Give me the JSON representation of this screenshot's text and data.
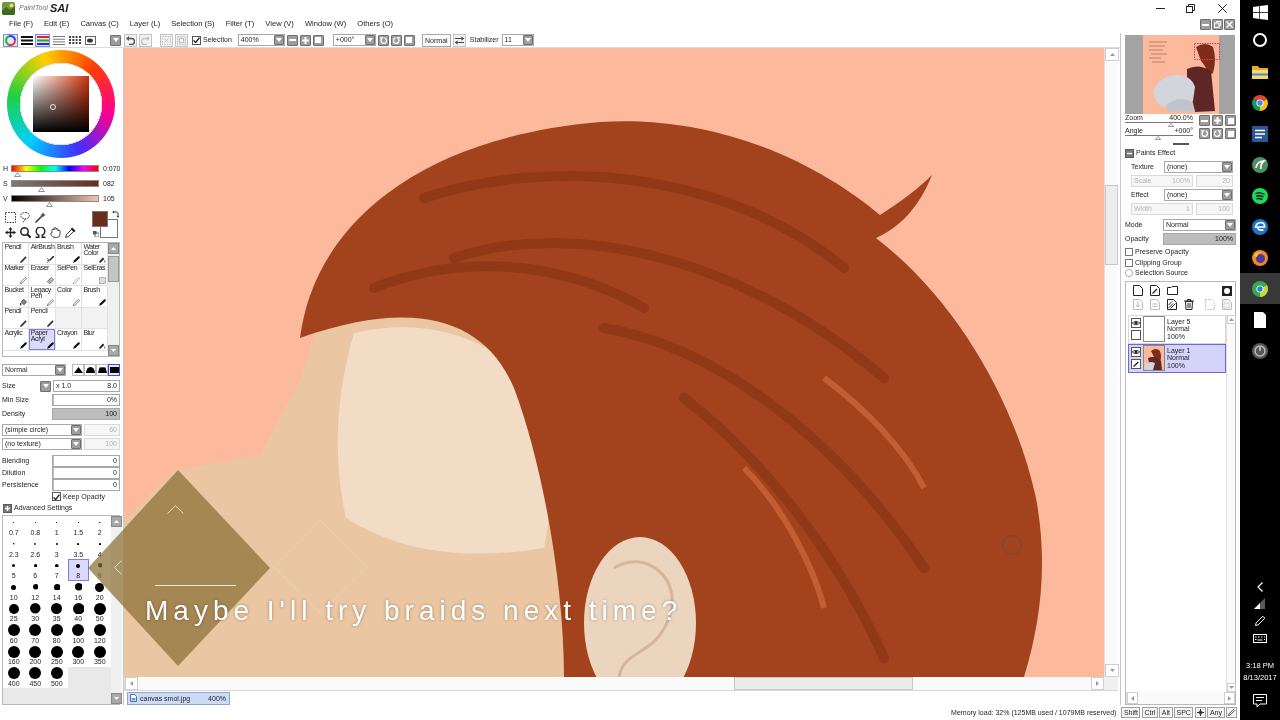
{
  "app_title": {
    "prefix": "PaintTool",
    "name": "SAI"
  },
  "menu": [
    "File (F)",
    "Edit (E)",
    "Canvas (C)",
    "Layer (L)",
    "Selection (S)",
    "Filter (T)",
    "View (V)",
    "Window (W)",
    "Others (O)"
  ],
  "toolbar": {
    "panel_toggles": [
      {
        "kind": "wheel",
        "selected": true
      },
      {
        "kind": "bars",
        "selected": false
      },
      {
        "kind": "rgb",
        "selected": true
      },
      {
        "kind": "lines",
        "selected": false
      },
      {
        "kind": "dots",
        "selected": false
      },
      {
        "kind": "pad",
        "selected": false
      }
    ],
    "edit_buttons": [
      {
        "kind": "undo",
        "disabled": false
      },
      {
        "kind": "redo",
        "disabled": true
      },
      {
        "kind": "deselect",
        "disabled": true
      },
      {
        "kind": "invert",
        "disabled": true
      }
    ],
    "selection": {
      "label": "Selection",
      "checked": true
    },
    "zoom": "400%",
    "angle": "+000°",
    "mode_button": "Normal",
    "stabilizer": {
      "label": "Stabilizer",
      "value": "11"
    }
  },
  "color_panel": {
    "sliders": [
      {
        "kind": "hue",
        "label": "H",
        "level": 0.07,
        "reading": "0:070"
      },
      {
        "kind": "saturation",
        "label": "S",
        "level": 0.35,
        "reading": "082"
      },
      {
        "kind": "value",
        "label": "V",
        "level": 0.44,
        "reading": "105"
      }
    ],
    "swatches": [
      {
        "kind": "foreground",
        "color": "#6b2e1c"
      },
      {
        "kind": "background",
        "color": "#ffffff"
      }
    ]
  },
  "tool_rows": [
    [
      {
        "label": "Pencil",
        "kind": "pen",
        "selected": false
      },
      {
        "label": "AirBrush",
        "kind": "spray",
        "selected": false
      },
      {
        "label": "Brush",
        "kind": "brush",
        "selected": false
      },
      {
        "label": "Water Color",
        "kind": "water",
        "selected": false
      }
    ],
    [
      {
        "label": "Marker",
        "kind": "marker",
        "selected": false
      },
      {
        "label": "Eraser",
        "kind": "eraser",
        "selected": false
      },
      {
        "label": "SelPen",
        "kind": "selpen",
        "selected": false
      },
      {
        "label": "SelEras",
        "kind": "seleras",
        "selected": false
      }
    ],
    [
      {
        "label": "Bucket",
        "kind": "bucket",
        "selected": false
      },
      {
        "label": "Legacy Pen",
        "kind": "marker",
        "selected": false
      },
      {
        "label": "Color",
        "kind": "marker",
        "selected": false
      },
      {
        "label": "Brush",
        "kind": "brush",
        "selected": false
      }
    ],
    [
      {
        "label": "Pencil",
        "kind": "pen",
        "selected": false
      },
      {
        "label": "Pencil",
        "kind": "pen",
        "selected": false
      }
    ],
    [
      {
        "label": "Acrylic",
        "kind": "brush",
        "selected": false
      },
      {
        "label": "Paper Acryl",
        "kind": "brush",
        "selected": true
      },
      {
        "label": "Crayon",
        "kind": "brush",
        "selected": false
      },
      {
        "label": "Blur",
        "kind": "water",
        "selected": false
      }
    ]
  ],
  "brush_settings": {
    "blend_mode": "Normal",
    "tip_shapes": [
      {
        "kind": "pointed",
        "selected": false
      },
      {
        "kind": "round",
        "selected": false
      },
      {
        "kind": "flat",
        "selected": false
      },
      {
        "kind": "square",
        "selected": true
      }
    ],
    "size": {
      "label": "Size",
      "multiplier": "x 1.0",
      "value": "8.0"
    },
    "sliders": [
      {
        "label": "Min Size",
        "value": "0%",
        "level": 0
      },
      {
        "label": "Density",
        "value": "100",
        "level": 1
      }
    ],
    "shape": {
      "value": "(simple circle)",
      "amount": "60",
      "disabled": true
    },
    "texture": {
      "value": "(no texture)",
      "amount": "100",
      "disabled": true
    },
    "mixing": [
      {
        "label": "Blending",
        "value": "0",
        "level": 0
      },
      {
        "label": "Dilution",
        "value": "0",
        "level": 0
      },
      {
        "label": "Persistence",
        "value": "0",
        "level": 0
      }
    ],
    "keep_opacity": {
      "label": "Keep Opacity",
      "checked": true
    },
    "advanced": {
      "label": "Advanced Settings",
      "expanded": false
    }
  },
  "brush_sizes": [
    {
      "label": "0.7",
      "selected": false
    },
    {
      "label": "0.8",
      "selected": false
    },
    {
      "label": "1",
      "selected": false
    },
    {
      "label": "1.5",
      "selected": false
    },
    {
      "label": "2",
      "selected": false
    },
    {
      "label": "2.3",
      "selected": false
    },
    {
      "label": "2.6",
      "selected": false
    },
    {
      "label": "3",
      "selected": false
    },
    {
      "label": "3.5",
      "selected": false
    },
    {
      "label": "4",
      "selected": false
    },
    {
      "label": "5",
      "selected": false
    },
    {
      "label": "6",
      "selected": false
    },
    {
      "label": "7",
      "selected": false
    },
    {
      "label": "8",
      "selected": true
    },
    {
      "label": "9",
      "selected": false
    },
    {
      "label": "10",
      "selected": false
    },
    {
      "label": "12",
      "selected": false
    },
    {
      "label": "14",
      "selected": false
    },
    {
      "label": "16",
      "selected": false
    },
    {
      "label": "20",
      "selected": false
    },
    {
      "label": "25",
      "selected": false
    },
    {
      "label": "30",
      "selected": false
    },
    {
      "label": "35",
      "selected": false
    },
    {
      "label": "40",
      "selected": false
    },
    {
      "label": "50",
      "selected": false
    },
    {
      "label": "60",
      "selected": false
    },
    {
      "label": "70",
      "selected": false
    },
    {
      "label": "80",
      "selected": false
    },
    {
      "label": "100",
      "selected": false
    },
    {
      "label": "120",
      "selected": false
    },
    {
      "label": "160",
      "selected": false
    },
    {
      "label": "200",
      "selected": false
    },
    {
      "label": "250",
      "selected": false
    },
    {
      "label": "300",
      "selected": false
    },
    {
      "label": "350",
      "selected": false
    },
    {
      "label": "400",
      "selected": false
    },
    {
      "label": "450",
      "selected": false
    },
    {
      "label": "500",
      "selected": false
    }
  ],
  "video_caption": {
    "text": "Maybe I'll try braids next time?"
  },
  "navigator": {
    "zoom": {
      "label": "Zoom",
      "value": "400.0%",
      "level": 0.68
    },
    "angle": {
      "label": "Angle",
      "value": "+000°",
      "level": 0.48
    }
  },
  "paints_effect": {
    "title": "Paints Effect",
    "expanded": true,
    "rows": [
      {
        "kind": "select",
        "label": "Texture",
        "value": "(none)"
      },
      {
        "kind": "pair",
        "label": "Scale",
        "value": "100%",
        "amount": "20",
        "disabled": true
      },
      {
        "kind": "select",
        "label": "Effect",
        "value": "(none)"
      },
      {
        "kind": "pair",
        "label": "Width",
        "value": "1",
        "amount": "100",
        "disabled": true
      }
    ]
  },
  "layer_props": {
    "mode": {
      "label": "Mode",
      "value": "Normal"
    },
    "opacity": {
      "label": "Opacity",
      "value": "100%",
      "level": 1
    },
    "options": [
      {
        "kind": "checkbox",
        "label": "Preserve Opacity",
        "checked": false
      },
      {
        "kind": "checkbox",
        "label": "Clipping Group",
        "checked": false
      },
      {
        "kind": "radio",
        "label": "Selection Source",
        "checked": false
      }
    ]
  },
  "layer_tool_rows": [
    [
      {
        "kind": "new-layer",
        "disabled": false
      },
      {
        "kind": "new-linear",
        "disabled": false
      },
      {
        "kind": "new-folder",
        "disabled": false
      },
      {
        "kind": "mask",
        "disabled": false
      }
    ],
    [
      {
        "kind": "transfer",
        "disabled": true
      },
      {
        "kind": "merge",
        "disabled": true
      },
      {
        "kind": "clear",
        "disabled": false
      },
      {
        "kind": "delete",
        "disabled": false
      },
      {
        "kind": "to-selection",
        "disabled": true
      },
      {
        "kind": "from-selection",
        "disabled": true
      }
    ]
  ],
  "layers": [
    {
      "name": "Layer 5",
      "mode": "Normal",
      "opacity": "100%",
      "visible": true,
      "selected": false,
      "kind": "blank"
    },
    {
      "name": "Layer 1",
      "mode": "Normal",
      "opacity": "100%",
      "visible": true,
      "selected": true,
      "kind": "art"
    }
  ],
  "canvas_tabs": [
    {
      "name": "canvas smol.jpg",
      "zoom": "400%",
      "selected": true
    }
  ],
  "status_bar": {
    "memory": "Memory load: 32% (125MB used / 1079MB reserved)",
    "keys": [
      {
        "kind": "text",
        "label": "Shift"
      },
      {
        "kind": "text",
        "label": "Ctrl"
      },
      {
        "kind": "text",
        "label": "Alt"
      },
      {
        "kind": "text",
        "label": "SPC"
      },
      {
        "kind": "cursor"
      },
      {
        "kind": "text",
        "label": "Any"
      },
      {
        "kind": "pen"
      }
    ]
  },
  "taskbar": {
    "apps": [
      {
        "kind": "folder",
        "selected": false
      },
      {
        "kind": "sphere",
        "selected": false
      },
      {
        "kind": "tile",
        "selected": false
      },
      {
        "kind": "swirl",
        "selected": false
      },
      {
        "kind": "disc",
        "selected": false
      },
      {
        "kind": "wave",
        "selected": false
      },
      {
        "kind": "globe",
        "selected": false
      },
      {
        "kind": "leaf",
        "selected": true
      },
      {
        "kind": "page",
        "selected": false
      },
      {
        "kind": "dial",
        "selected": false
      }
    ],
    "time": "3:18 PM",
    "date": "8/13/2017"
  }
}
